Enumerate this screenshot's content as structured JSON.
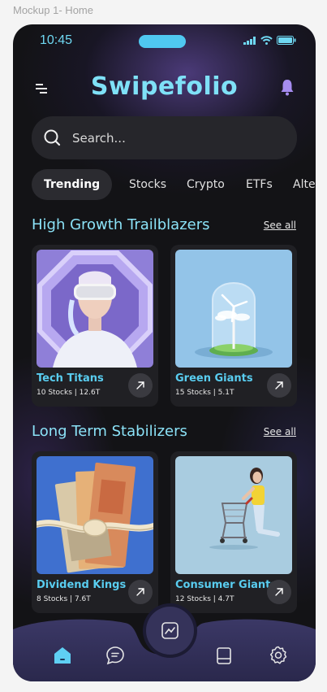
{
  "frame_label": "Mockup 1- Home",
  "status_bar": {
    "time": "10:45"
  },
  "header": {
    "title": "Swipefolio"
  },
  "search": {
    "placeholder": "Search..."
  },
  "tabs": [
    {
      "label": "Trending",
      "active": true
    },
    {
      "label": "Stocks",
      "active": false
    },
    {
      "label": "Crypto",
      "active": false
    },
    {
      "label": "ETFs",
      "active": false
    },
    {
      "label": "Alte",
      "active": false
    }
  ],
  "sections": [
    {
      "title": "High Growth Trailblazers",
      "see_all": "See all",
      "cards": [
        {
          "name": "Tech Titans",
          "meta": "10 Stocks | 12.6T",
          "image": "vr-headset-person"
        },
        {
          "name": "Green Giants",
          "meta": "15 Stocks | 5.1T",
          "image": "wind-turbine-in-glass-dome"
        }
      ]
    },
    {
      "title": "Long Term Stabilizers",
      "see_all": "See all",
      "cards": [
        {
          "name": "Dividend Kings",
          "meta": "8 Stocks | 7.6T",
          "image": "banknotes-tied-with-rope"
        },
        {
          "name": "Consumer Giants",
          "meta": "12 Stocks | 4.7T",
          "image": "woman-with-shopping-cart"
        }
      ]
    }
  ],
  "bottom_nav": {
    "items": [
      "home-icon",
      "chat-icon",
      "portfolio-chart-icon",
      "book-icon",
      "settings-icon"
    ],
    "active": "home-icon"
  },
  "colors": {
    "accent": "#7fe1f7",
    "card_title": "#59cdf0",
    "bell": "#a68cf0",
    "background": "#131316"
  }
}
